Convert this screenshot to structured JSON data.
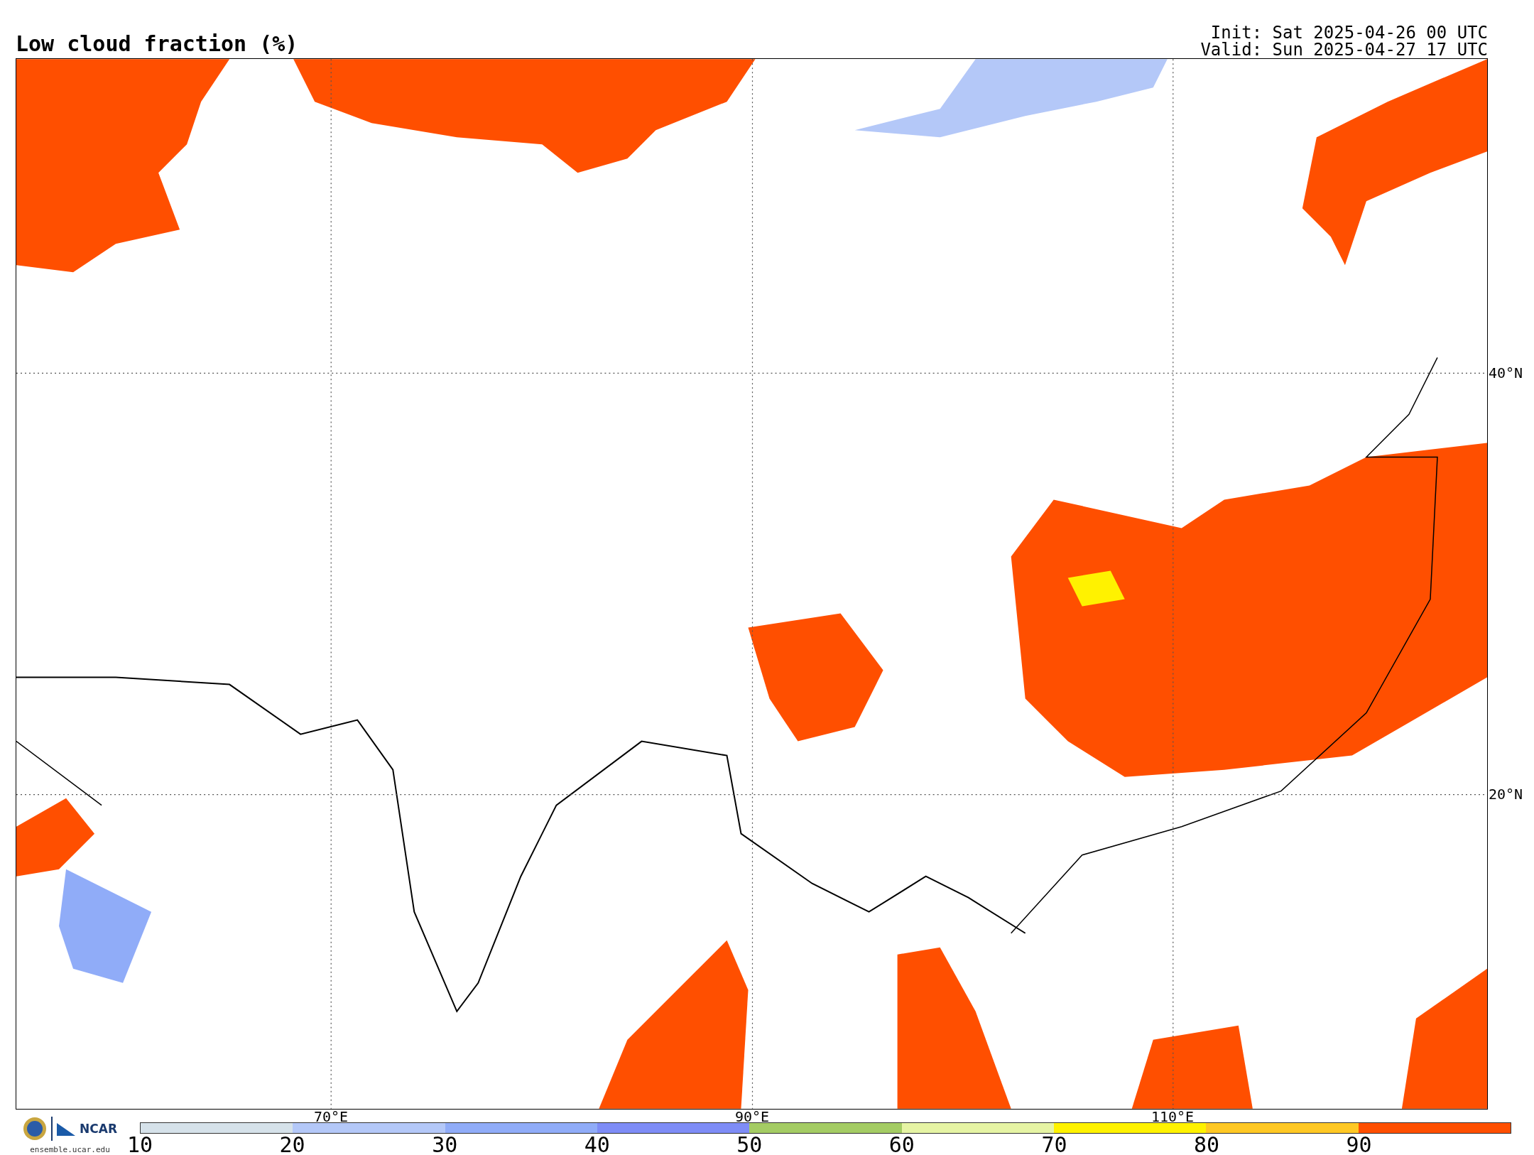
{
  "title": "Low cloud fraction (%)",
  "run_info": [
    "Init: Sat 2025-04-26 00 UTC",
    "Valid: Sun 2025-04-27 17 UTC"
  ],
  "map": {
    "lon_labels": [
      "70°E",
      "90°E",
      "110°E"
    ],
    "lat_labels": [
      "40°N",
      "20°N"
    ]
  },
  "logos": {
    "org": "NCAR",
    "site": "ensemble.ucar.edu"
  },
  "colorbar": {
    "segments": [
      {
        "label": "10",
        "color": "#d6e2ea"
      },
      {
        "label": "20",
        "color": "#b4c8f8"
      },
      {
        "label": "30",
        "color": "#90acf8"
      },
      {
        "label": "40",
        "color": "#7e8cf6"
      },
      {
        "label": "50",
        "color": "#a4cc64"
      },
      {
        "label": "60",
        "color": "#e6f4a4"
      },
      {
        "label": "70",
        "color": "#fff200"
      },
      {
        "label": "80",
        "color": "#ffc824"
      },
      {
        "label": "90",
        "color": "#ff4f00"
      }
    ]
  }
}
